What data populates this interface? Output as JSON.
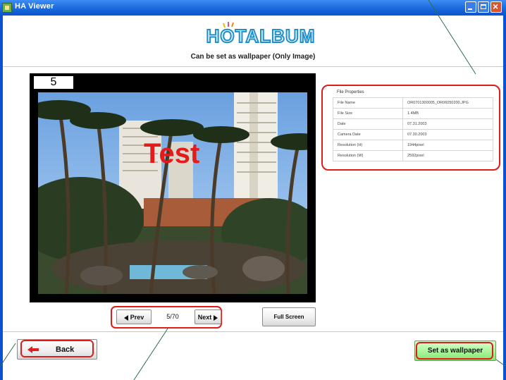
{
  "window": {
    "title": "HA Viewer",
    "controls": [
      "minimize",
      "maximize",
      "close"
    ]
  },
  "header": {
    "logo": "HOTALBUM",
    "subtitle": "Can be set as wallpaper (Only Image)"
  },
  "photo": {
    "number": "5",
    "overlay_text": "Test"
  },
  "file_properties": {
    "title": "File Properties",
    "rows": [
      {
        "key": "File Name",
        "value": "OR0701300005_OR06050200.JPG"
      },
      {
        "key": "File Size",
        "value": "1.4MB"
      },
      {
        "key": "Date",
        "value": "07.31.2003"
      },
      {
        "key": "Camera Date",
        "value": "07.30.2003"
      },
      {
        "key": "Resolution (H)",
        "value": "1944pixel"
      },
      {
        "key": "Resolution (W)",
        "value": "2592pixel"
      }
    ]
  },
  "navigation": {
    "prev_label": "Prev",
    "counter": "5/70",
    "next_label": "Next",
    "fullscreen_label": "Full Screen"
  },
  "footer": {
    "back_label": "Back",
    "wallpaper_label": "Set as wallpaper"
  },
  "colors": {
    "highlight": "#dd1c1c",
    "titlebar": "#0a52cf",
    "wallpaper_button": "#aaf59a",
    "logo": "#1f8fce"
  }
}
